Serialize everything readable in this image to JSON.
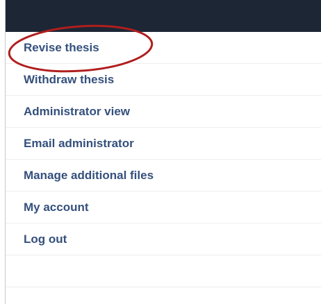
{
  "menu": {
    "items": [
      {
        "label": "Revise thesis"
      },
      {
        "label": "Withdraw thesis"
      },
      {
        "label": "Administrator view"
      },
      {
        "label": "Email administrator"
      },
      {
        "label": "Manage additional files"
      },
      {
        "label": "My account"
      },
      {
        "label": "Log out"
      }
    ]
  },
  "colors": {
    "header_bar": "#1d2635",
    "link_text": "#34507c",
    "highlight_annotation": "#b01e1e",
    "divider": "#eeeeee"
  }
}
